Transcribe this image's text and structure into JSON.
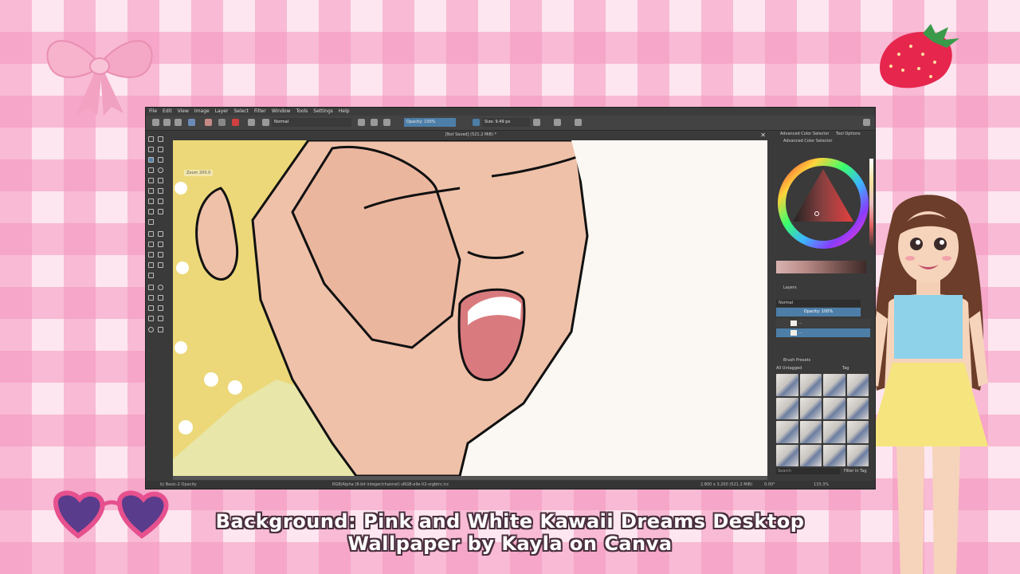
{
  "window": {
    "menu": [
      "File",
      "Edit",
      "View",
      "Image",
      "Layer",
      "Select",
      "Filter",
      "Window",
      "Tools",
      "Settings",
      "Help"
    ],
    "document_title": "[Not Saved]  (521.2 MiB) *",
    "zoom_hint": "Zoom 200.0",
    "toolbar": {
      "blend_mode": "Normal",
      "opacity": "Opacity: 100%",
      "size": "Size: 9.49 px"
    },
    "status": {
      "brush": "b) Basic-2 Opacity",
      "color_space": "RGB/Alpha (8-bit integer/channel)  sRGB-elle-V2-srgbtrc.icc",
      "dimensions": "2,800 x 3,200 (521.2 MiB)",
      "rotation": "0.00°",
      "zoom": "133.3%"
    }
  },
  "dock": {
    "tabs": [
      "Advanced Color Selector",
      "Tool Options"
    ],
    "color_selector_title": "Advanced Color Selector",
    "layers_title": "Layers",
    "layers_blend": "Normal",
    "layers_opacity": "Opacity: 100%",
    "layers": [
      {
        "name": "..."
      },
      {
        "name": "..."
      }
    ],
    "brush_presets_title": "Brush Presets",
    "brush_filter": "All Untagged",
    "brush_tag": "Tag",
    "brush_search": "Search",
    "filter_in_tag": "Filter in Tag"
  },
  "caption": {
    "line1": "Background: Pink and White Kawaii Dreams Desktop",
    "line2": "Wallpaper by Kayla  on Canva"
  },
  "colors": {
    "pink_check": "#f496be",
    "skin": "#efc1a9",
    "hair": "#ecd879",
    "mouth": "#d97b7e",
    "krita_accent": "#4d7ea8"
  }
}
